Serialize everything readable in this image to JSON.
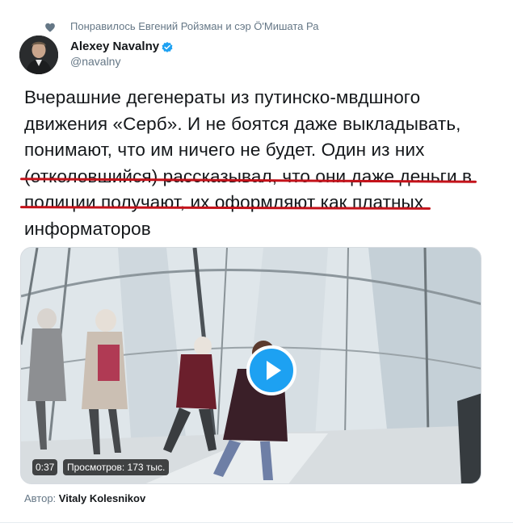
{
  "social_context": {
    "icon": "heart-icon",
    "text": "Понравилось Евгений Ройзман и сэр Ӧ'Мишата Ра"
  },
  "author": {
    "name": "Alexey Navalny",
    "handle": "@navalny",
    "verified": true,
    "avatar": "avatar"
  },
  "tweet": {
    "lines": [
      "Вчерашние дегенераты из путинско-мвдшного",
      "движения «Серб». И не боятся даже выкладывать,",
      "понимают, что им ничего не будет. Один из них",
      "(отколовшийся) рассказывал, что они даже деньги в",
      "полиции получают, их оформляют как платных",
      "информаторов"
    ],
    "underline_color": "#c4121a"
  },
  "video": {
    "duration": "0:37",
    "views": "Просмотров: 173 тыс.",
    "play_icon": "play-icon",
    "accent": "#1da1f2"
  },
  "attribution": {
    "label": "Автор:",
    "name": "Vitaly Kolesnikov"
  }
}
